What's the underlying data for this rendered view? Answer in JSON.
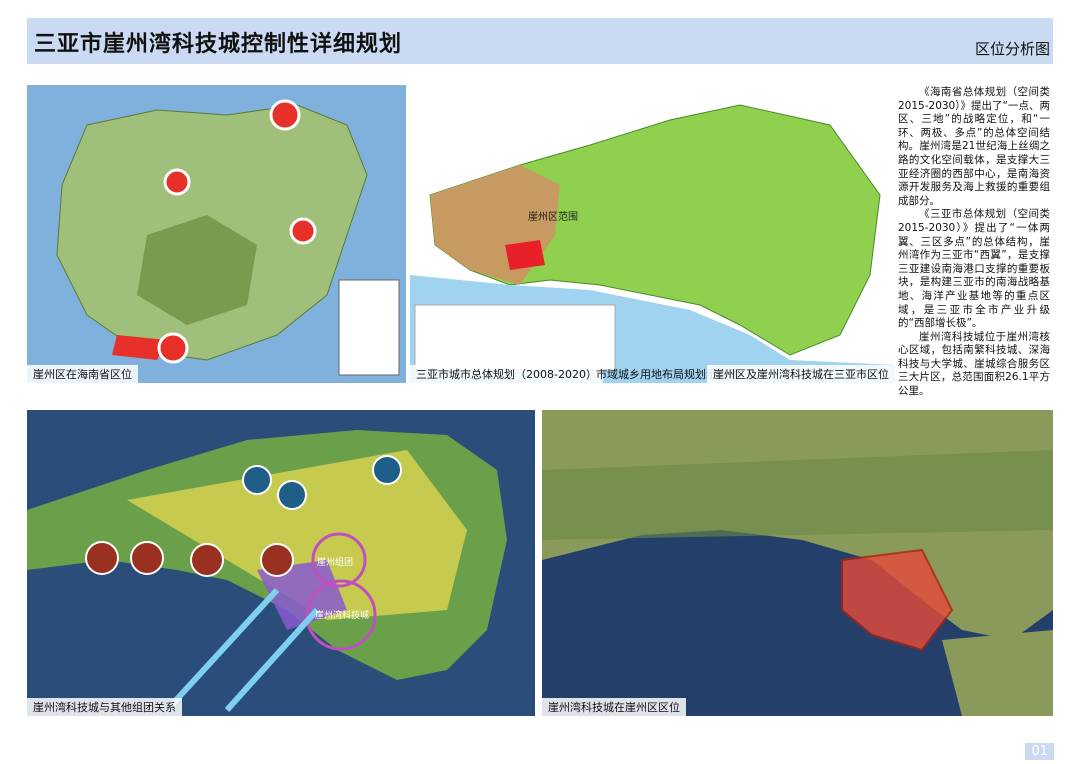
{
  "header": {
    "title": "三亚市崖州湾科技城控制性详细规划",
    "subtitle": "区位分析图"
  },
  "panels": {
    "map1_caption": "崖州区在海南省区位",
    "map2_caption_left": "三亚市城市总体规划（2008-2020）",
    "map2_caption_mid": "市域城乡用地布局规划示意图",
    "map2_caption_right": "崖州区及崖州湾科技城在三亚市区位",
    "map2_region_label": "崖州区范围",
    "map3_caption": "崖州湾科技城与其他组团关系",
    "map4_caption": "崖州湾科技城在崖州区区位",
    "map3_labels": [
      "崖州组团",
      "崖州湾科技城"
    ]
  },
  "text": {
    "paragraph1": "《海南省总体规划（空间类2015-2030）》提出了“一点、两区、三地”的战略定位，和“一环、两极、多点”的总体空间结构。崖州湾是21世纪海上丝绸之路的文化空间载体，是支撑大三亚经济圈的西部中心，是南海资源开发服务及海上救援的重要组成部分。",
    "paragraph2": "《三亚市总体规划（空间类2015-2030）》提出了“一体两翼、三区多点”的总体结构，崖州湾作为三亚市“西翼”，是支撑三亚建设南海港口支撑的重要板块，是构建三亚市的南海战略基地、海洋产业基地等的重点区域，是三亚市全市产业升级的“西部增长极”。",
    "paragraph3": "崖州湾科技城位于崖州湾核心区域，包括南繁科技城、深海科技与大学城、崖城综合服务区三大片区，总范围面积26.1平方公里。"
  },
  "footer": {
    "page_number": "01"
  },
  "colors": {
    "banner": "#c9daf2",
    "land_green": "#8fd14f",
    "sea_blue": "#2a4d7a",
    "highlight_red": "#e8202a"
  }
}
